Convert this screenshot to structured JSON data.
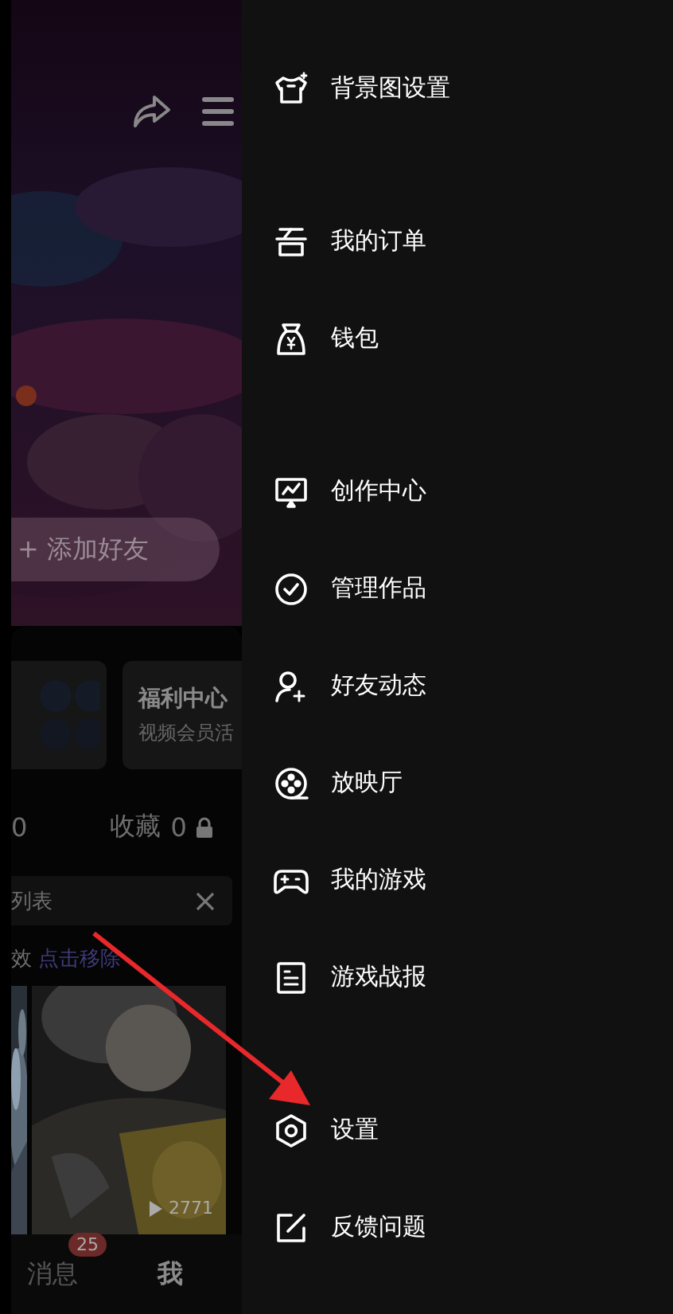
{
  "profile": {
    "add_friend_button": "+ 添加好友",
    "cards": [
      {
        "kind": "avatars"
      },
      {
        "kind": "text",
        "title": "福利中心",
        "subtitle": "视频会员活"
      }
    ],
    "stats": [
      {
        "value": "0",
        "locked": false
      },
      {
        "label": "收藏",
        "value": "0",
        "locked": true
      }
    ],
    "banner": {
      "text": "列表"
    },
    "notice": {
      "text": "效",
      "link": "点击移除"
    },
    "videos": [
      {
        "kind": "picture"
      },
      {
        "kind": "picture",
        "plays": "2771"
      }
    ],
    "bottom_nav": [
      {
        "label": "消息",
        "badge": "25",
        "selected": false
      },
      {
        "label": "我",
        "selected": true
      }
    ]
  },
  "drawer": {
    "groups": [
      [
        {
          "label": "背景图设置"
        }
      ],
      [
        {
          "label": "我的订单"
        },
        {
          "label": "钱包"
        }
      ],
      [
        {
          "label": "创作中心"
        },
        {
          "label": "管理作品"
        },
        {
          "label": "好友动态"
        },
        {
          "label": "放映厅"
        },
        {
          "label": "我的游戏"
        },
        {
          "label": "游戏战报"
        }
      ],
      [
        {
          "label": "设置"
        },
        {
          "label": "反馈问题"
        }
      ]
    ]
  }
}
